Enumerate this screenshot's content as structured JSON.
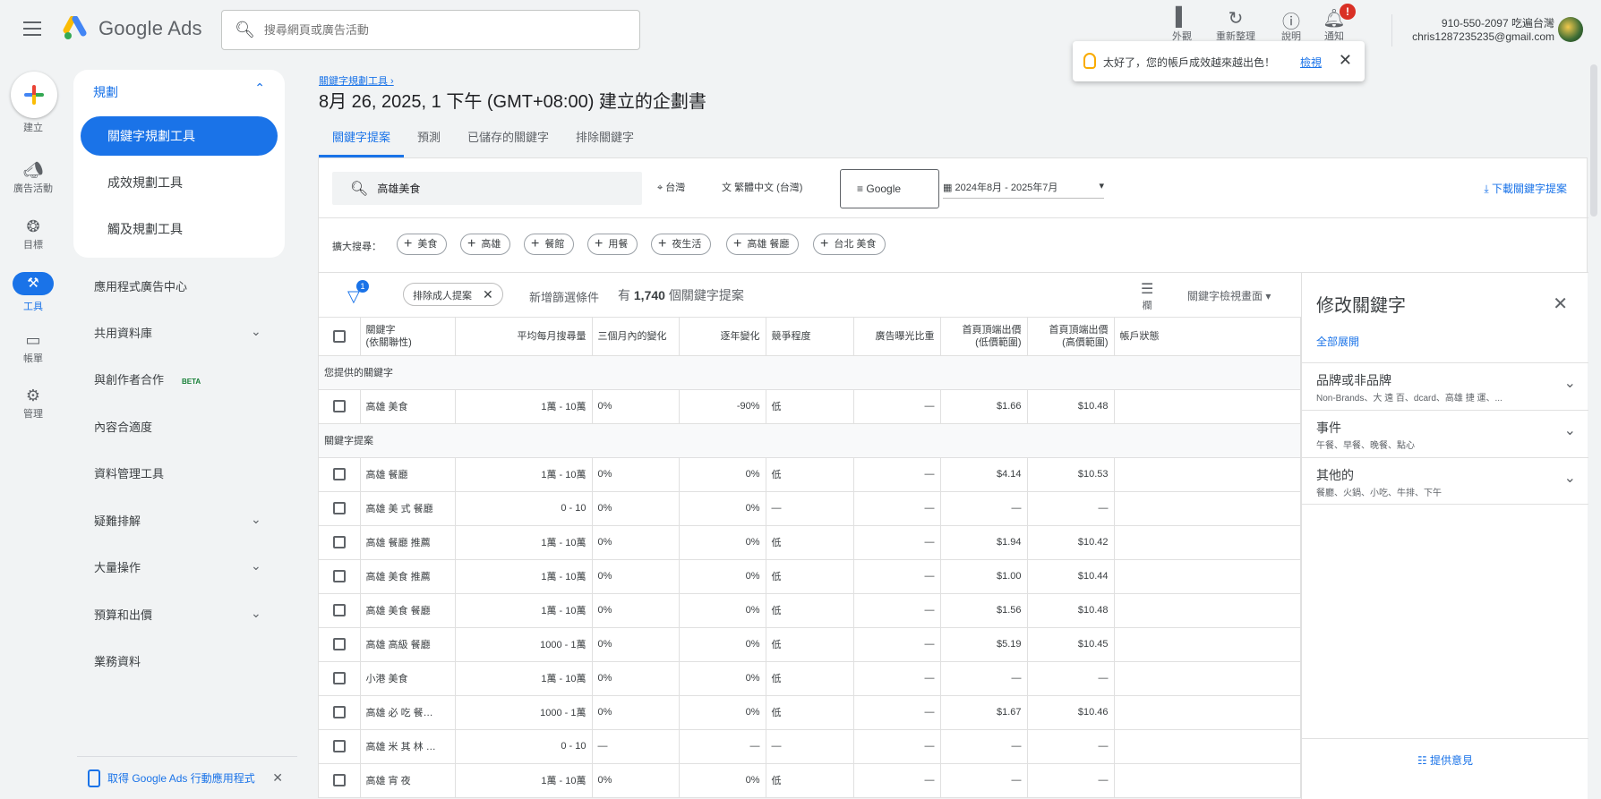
{
  "app": {
    "logo_text": "Google Ads",
    "search_placeholder": "搜尋網頁或廣告活動"
  },
  "header": {
    "icons": [
      {
        "label": "外觀",
        "icon": "appearance-icon"
      },
      {
        "label": "重新整理",
        "icon": "refresh-icon"
      },
      {
        "label": "說明",
        "icon": "help-icon"
      },
      {
        "label": "通知",
        "icon": "bell-icon",
        "badge": "!"
      }
    ],
    "account_id": "910-550-2097 吃遍台灣",
    "account_email": "chris1287235235@gmail.com"
  },
  "toast": {
    "message": "太好了，您的帳戶成效越來越出色！",
    "link": "檢視"
  },
  "rail": [
    {
      "label": "建立"
    },
    {
      "label": "廣告活動",
      "icon": "megaphone-icon"
    },
    {
      "label": "目標",
      "icon": "trophy-icon"
    },
    {
      "label": "工具",
      "icon": "tools-icon"
    },
    {
      "label": "帳單",
      "icon": "credit-card-icon"
    },
    {
      "label": "管理",
      "icon": "gear-icon"
    }
  ],
  "nav": {
    "section": "規劃",
    "items": [
      "關鍵字規劃工具",
      "成效規劃工具",
      "觸及規劃工具"
    ],
    "more": [
      "應用程式廣告中心",
      "共用資料庫",
      "與創作者合作",
      "內容合適度",
      "資料管理工具",
      "疑難排解",
      "大量操作",
      "預算和出價",
      "業務資料"
    ],
    "beta": "BETA",
    "promo": "取得 Google Ads 行動應用程式"
  },
  "page": {
    "breadcrumb": "關鍵字規劃工具",
    "title": "8月 26, 2025, 1 下午 (GMT+08:00) 建立的企劃書",
    "tabs": [
      "關鍵字提案",
      "預測",
      "已儲存的關鍵字",
      "排除關鍵字"
    ]
  },
  "filters": {
    "keyword": "高雄美食",
    "location": "台灣",
    "language": "繁體中文 (台灣)",
    "network": "Google",
    "date": "2024年8月 - 2025年7月",
    "download": "下載關鍵字提案"
  },
  "broaden": {
    "label": "擴大搜尋：",
    "chips": [
      "美食",
      "高雄",
      "餐館",
      "用餐",
      "夜生活",
      "高雄 餐廳",
      "台北 美食"
    ]
  },
  "table_controls": {
    "filter_count": "1",
    "exclude_chip": "排除成人提案",
    "add_filter": "新增篩選條件",
    "count_prefix": "有",
    "count": "1,740",
    "count_suffix": "個關鍵字提案",
    "columns_label": "欄",
    "view": "關鍵字檢視畫面"
  },
  "table": {
    "headers": [
      "關鍵字\n(依關聯性)",
      "平均每月搜尋量",
      "三個月內的變化",
      "逐年變化",
      "競爭程度",
      "廣告曝光比重",
      "首頁頂端出價\n(低價範圍)",
      "首頁頂端出價\n(高價範圍)",
      "帳戶狀態"
    ],
    "group1": "您提供的關鍵字",
    "provided": [
      [
        "高雄 美食",
        "1萬 - 10萬",
        "0%",
        "-90%",
        "低",
        "—",
        "$1.66",
        "$10.48",
        ""
      ]
    ],
    "group2": "關鍵字提案",
    "ideas": [
      [
        "高雄 餐廳",
        "1萬 - 10萬",
        "0%",
        "0%",
        "低",
        "—",
        "$4.14",
        "$10.53",
        ""
      ],
      [
        "高雄 美 式 餐廳",
        "0 - 10",
        "0%",
        "0%",
        "—",
        "—",
        "—",
        "—",
        ""
      ],
      [
        "高雄 餐廳 推薦",
        "1萬 - 10萬",
        "0%",
        "0%",
        "低",
        "—",
        "$1.94",
        "$10.42",
        ""
      ],
      [
        "高雄 美食 推薦",
        "1萬 - 10萬",
        "0%",
        "0%",
        "低",
        "—",
        "$1.00",
        "$10.44",
        ""
      ],
      [
        "高雄 美食 餐廳",
        "1萬 - 10萬",
        "0%",
        "0%",
        "低",
        "—",
        "$1.56",
        "$10.48",
        ""
      ],
      [
        "高雄 高級 餐廳",
        "1000 - 1萬",
        "0%",
        "0%",
        "低",
        "—",
        "$5.19",
        "$10.45",
        ""
      ],
      [
        "小港 美食",
        "1萬 - 10萬",
        "0%",
        "0%",
        "低",
        "—",
        "—",
        "—",
        ""
      ],
      [
        "高雄 必 吃 餐…",
        "1000 - 1萬",
        "0%",
        "0%",
        "低",
        "—",
        "$1.67",
        "$10.46",
        ""
      ],
      [
        "高雄 米 其 林 …",
        "0 - 10",
        "—",
        "—",
        "—",
        "—",
        "—",
        "—",
        ""
      ],
      [
        "高雄 宵 夜",
        "1萬 - 10萬",
        "0%",
        "0%",
        "低",
        "—",
        "—",
        "—",
        ""
      ]
    ]
  },
  "panel": {
    "title": "修改關鍵字",
    "expand_all": "全部展開",
    "sections": [
      {
        "title": "品牌或非品牌",
        "sub": "Non-Brands、大 遠 百、dcard、高雄 捷 運、..."
      },
      {
        "title": "事件",
        "sub": "午餐、早餐、晚餐、點心"
      },
      {
        "title": "其他的",
        "sub": "餐廳、火鍋、小吃、牛排、下午"
      }
    ],
    "feedback": "提供意見"
  }
}
